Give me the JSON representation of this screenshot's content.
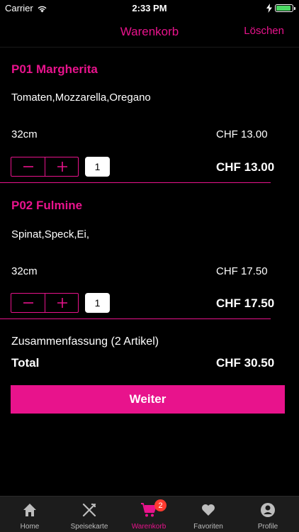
{
  "status_bar": {
    "carrier": "Carrier",
    "time": "2:33 PM"
  },
  "nav": {
    "title": "Warenkorb",
    "action": "Löschen"
  },
  "items": [
    {
      "name": "P01 Margherita",
      "description": "Tomaten,Mozzarella,Oregano",
      "size": "32cm",
      "unit_price": "CHF 13.00",
      "quantity": "1",
      "total": "CHF 13.00"
    },
    {
      "name": "P02 Fulmine",
      "description": "Spinat,Speck,Ei,",
      "size": "32cm",
      "unit_price": "CHF 17.50",
      "quantity": "1",
      "total": "CHF 17.50"
    }
  ],
  "summary": {
    "label": "Zusammenfassung (2 Artikel)",
    "total_label": "Total",
    "total_value": "CHF 30.50"
  },
  "cta_label": "Weiter",
  "tabs": [
    {
      "label": "Home",
      "icon": "home-icon"
    },
    {
      "label": "Speisekarte",
      "icon": "fork-knife-icon"
    },
    {
      "label": "Warenkorb",
      "icon": "cart-icon",
      "badge": "2",
      "active": true
    },
    {
      "label": "Favoriten",
      "icon": "heart-icon"
    },
    {
      "label": "Profile",
      "icon": "user-icon"
    }
  ],
  "colors": {
    "accent": "#e8138c",
    "background": "#000000",
    "tabbar": "#1c1c1c",
    "badge": "#ff3b30"
  }
}
